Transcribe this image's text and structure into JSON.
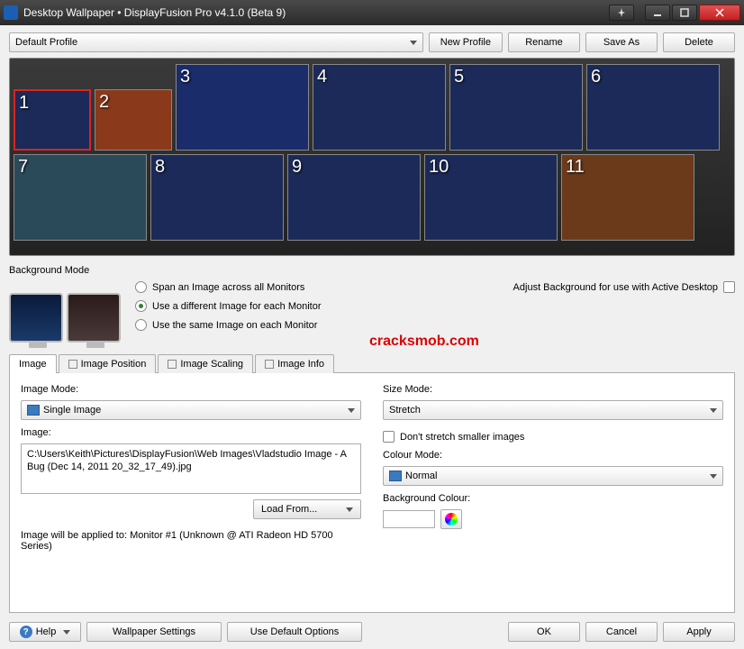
{
  "window": {
    "title": "Desktop Wallpaper • DisplayFusion Pro v4.1.0 (Beta 9)"
  },
  "profile": {
    "selected": "Default Profile",
    "buttons": {
      "new": "New Profile",
      "rename": "Rename",
      "saveas": "Save As",
      "delete": "Delete"
    }
  },
  "thumbs": [
    "1",
    "2",
    "3",
    "4",
    "5",
    "6",
    "7",
    "8",
    "9",
    "10",
    "11"
  ],
  "bgmode": {
    "label": "Background Mode",
    "opts": {
      "span": "Span an Image across all Monitors",
      "diff": "Use a different Image for each Monitor",
      "same": "Use the same Image on each Monitor"
    },
    "selected": "diff",
    "adjust": "Adjust Background for use with Active Desktop"
  },
  "watermark": "cracksmob.com",
  "tabs": {
    "image": "Image",
    "pos": "Image Position",
    "scale": "Image Scaling",
    "info": "Image Info"
  },
  "imageTab": {
    "imageModeLabel": "Image Mode:",
    "imageMode": "Single Image",
    "imageLabel": "Image:",
    "imagePath": "C:\\Users\\Keith\\Pictures\\DisplayFusion\\Web Images\\Vladstudio Image - A Bug (Dec 14, 2011 20_32_17_49).jpg",
    "loadFrom": "Load From...",
    "sizeModeLabel": "Size Mode:",
    "sizeMode": "Stretch",
    "dontStretch": "Don't stretch smaller images",
    "colourModeLabel": "Colour Mode:",
    "colourMode": "Normal",
    "bgColourLabel": "Background Colour:",
    "status": "Image will be applied to: Monitor #1 (Unknown @ ATI Radeon HD 5700 Series)"
  },
  "bottom": {
    "help": "Help",
    "wpsettings": "Wallpaper Settings",
    "defaults": "Use Default Options",
    "ok": "OK",
    "cancel": "Cancel",
    "apply": "Apply"
  }
}
